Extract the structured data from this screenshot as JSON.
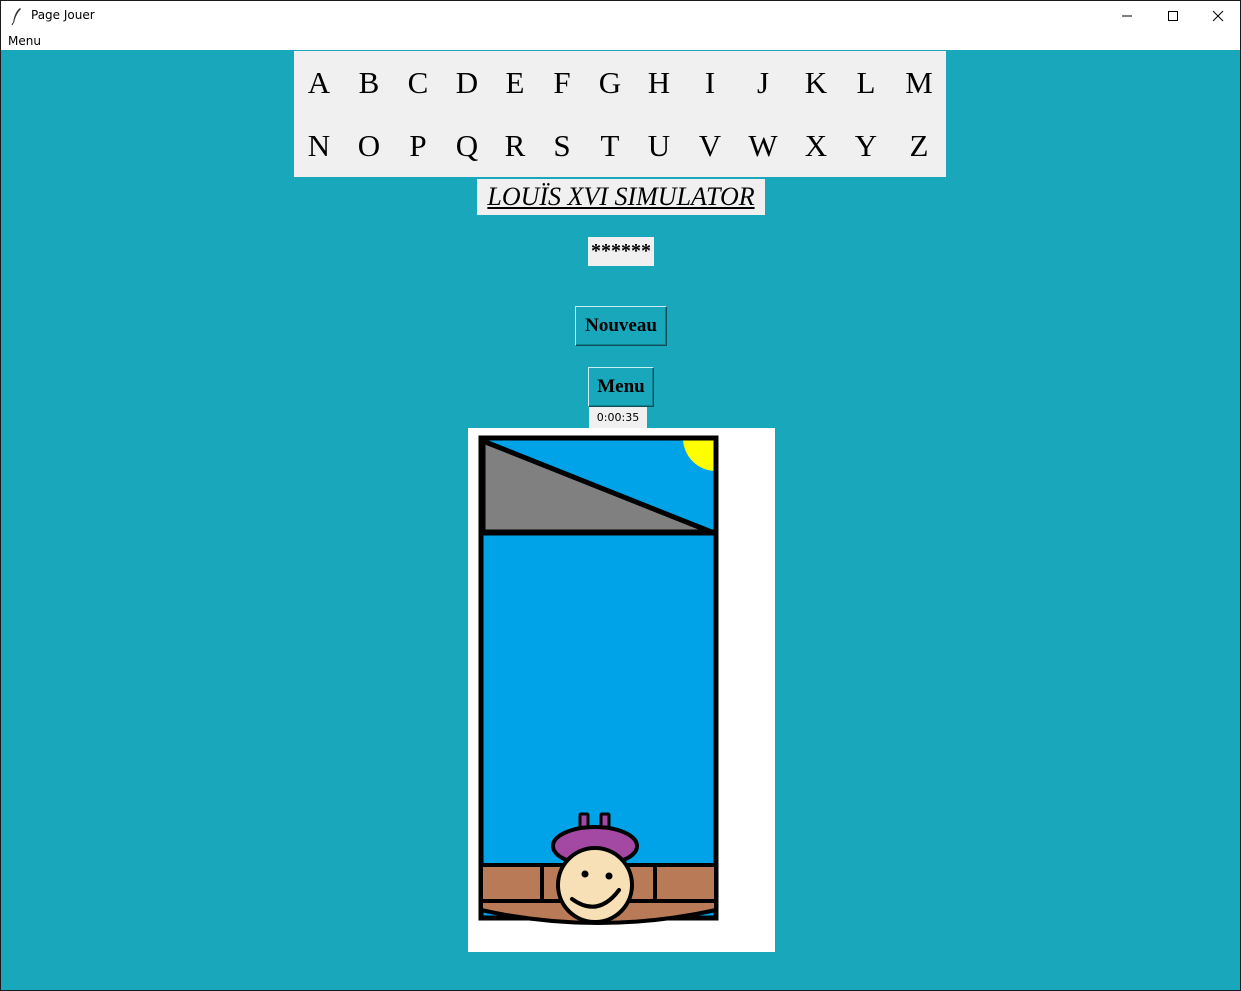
{
  "window": {
    "title": "Page Jouer"
  },
  "menubar": {
    "menu_label": "Menu"
  },
  "alphabet": {
    "row1": [
      "A",
      "B",
      "C",
      "D",
      "E",
      "F",
      "G",
      "H",
      "I",
      "J",
      "K",
      "L",
      "M"
    ],
    "row2": [
      "N",
      "O",
      "P",
      "Q",
      "R",
      "S",
      "T",
      "U",
      "V",
      "W",
      "X",
      "Y",
      "Z"
    ]
  },
  "game": {
    "title": "LOUÏS XVI SIMULATOR",
    "secret_word": "******",
    "new_button": "Nouveau",
    "menu_button": "Menu",
    "timer": "0:00:35"
  },
  "colors": {
    "background": "#19a7bb",
    "panel": "#f0f0f0",
    "sky": "#00a2e8",
    "blade": "#808080",
    "sun": "#ffff00",
    "brick": "#b97a57",
    "beret": "#a349a4",
    "face": "#f7e0b5"
  }
}
